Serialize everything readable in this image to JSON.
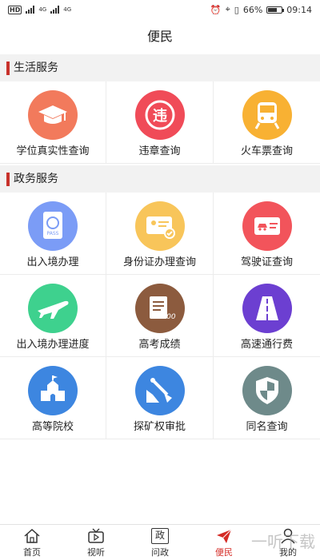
{
  "status_bar": {
    "left_icons": [
      "hd-icon",
      "signal-icon",
      "signal-icon"
    ],
    "network_labels": [
      "4G",
      "4G"
    ],
    "battery_percent": "66%",
    "battery_level": 0.66,
    "time": "09:14"
  },
  "header": {
    "title": "便民"
  },
  "sections": [
    {
      "label": "生活服务",
      "items": [
        {
          "label": "学位真实性查询",
          "icon": "graduation-cap-icon",
          "color": "#f27a5c"
        },
        {
          "label": "违章查询",
          "icon": "traffic-violation-icon",
          "color": "#f04b58"
        },
        {
          "label": "火车票查询",
          "icon": "train-icon",
          "color": "#f8b133"
        }
      ]
    },
    {
      "label": "政务服务",
      "items": [
        {
          "label": "出入境办理",
          "icon": "passport-icon",
          "color": "#7b9cf6"
        },
        {
          "label": "身份证办理查询",
          "icon": "id-card-icon",
          "color": "#f8c55a"
        },
        {
          "label": "驾驶证查询",
          "icon": "driver-license-icon",
          "color": "#f2545b"
        },
        {
          "label": "出入境办理进度",
          "icon": "airplane-icon",
          "color": "#3ed18e"
        },
        {
          "label": "高考成绩",
          "icon": "exam-score-icon",
          "color": "#8c5b3e"
        },
        {
          "label": "高速通行费",
          "icon": "highway-icon",
          "color": "#6c3fd1"
        },
        {
          "label": "高等院校",
          "icon": "university-icon",
          "color": "#3d86e0"
        },
        {
          "label": "探矿权审批",
          "icon": "mining-icon",
          "color": "#3d86e0"
        },
        {
          "label": "同名查询",
          "icon": "shield-icon",
          "color": "#6e8a8a"
        }
      ]
    }
  ],
  "tab_bar": {
    "items": [
      {
        "label": "首页",
        "icon": "home-icon",
        "active": false
      },
      {
        "label": "视听",
        "icon": "tv-icon",
        "active": false
      },
      {
        "label": "问政",
        "icon": "ask-gov-icon",
        "glyph": "政",
        "active": false
      },
      {
        "label": "便民",
        "icon": "send-icon",
        "active": true
      },
      {
        "label": "我的",
        "icon": "person-icon",
        "active": false
      }
    ]
  },
  "watermark": {
    "text": "一听下载"
  },
  "colors": {
    "accent": "#d42a24",
    "section_bar": "#c8312b",
    "section_bg": "#f2f2f2"
  }
}
